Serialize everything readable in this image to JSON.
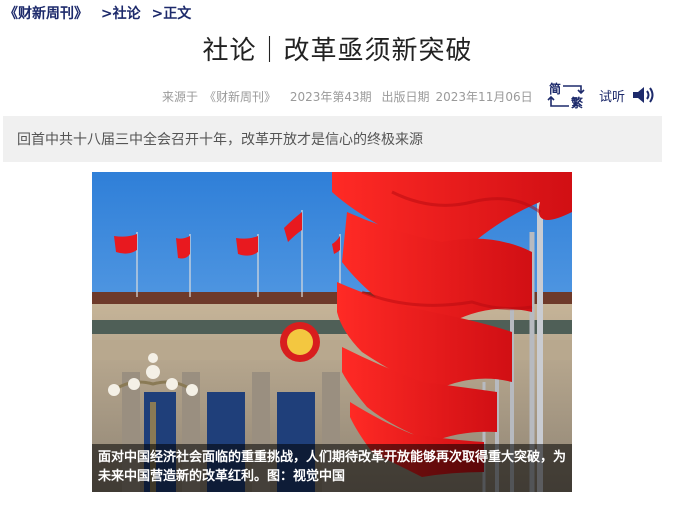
{
  "breadcrumb": {
    "publication": "《财新周刊》",
    "section": ">社论",
    "current": ">正文"
  },
  "article": {
    "title": "社论｜改革亟须新突破",
    "meta": {
      "source_prefix": "来源于",
      "source": "《财新周刊》",
      "issue": "2023年第43期",
      "date_label": "出版日期",
      "date": "2023年11月06日"
    },
    "summary": "回首中共十八届三中全会召开十年，改革开放才是信心的终极来源",
    "image_caption": "面对中国经济社会面临的重重挑战，人们期待改革开放能够再次取得重大突破，为未来中国营造新的改革红利。图：视觉中国"
  },
  "tools": {
    "simplified_char": "简",
    "traditional_char": "繁",
    "listen_label": "试听"
  },
  "colors": {
    "brand_navy": "#1d2a6b",
    "flag_red": "#e8191f",
    "sky_blue": "#3f8fe0"
  }
}
